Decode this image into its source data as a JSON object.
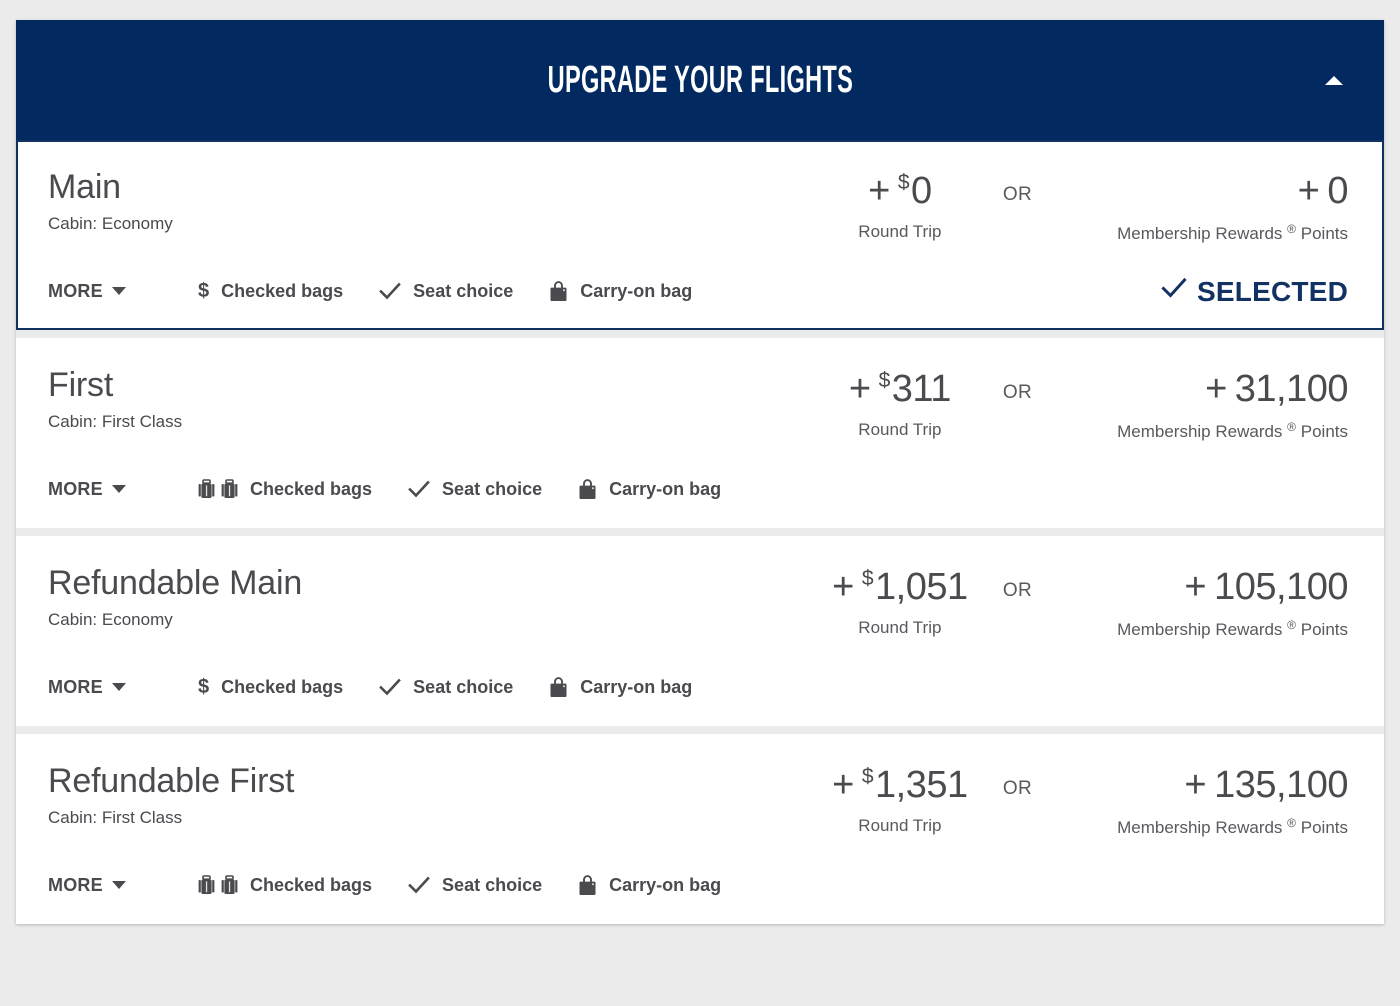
{
  "header": {
    "title": "UPGRADE YOUR FLIGHTS",
    "collapse_icon": "caret-up-icon",
    "background_color": "#032a60"
  },
  "theme": {
    "page_background": "#ebebeb",
    "navy": "#123263",
    "header_navy": "#032a60",
    "text_gray": "#4a4a4f",
    "muted_gray": "#59595e"
  },
  "labels": {
    "more": "MORE",
    "or": "OR",
    "round_trip": "Round Trip",
    "points_label": "Membership Rewards",
    "points_reg": "®",
    "points_suffix": "Points",
    "plus": "+",
    "currency_symbol": "$",
    "selected": "SELECTED"
  },
  "fares": [
    {
      "name": "Main",
      "cabin": "Cabin: Economy",
      "cash_amount": "0",
      "points_amount": "0",
      "selected": true,
      "features": [
        {
          "icon": "dollar-icon",
          "label": "Checked bags",
          "icon_count": 1
        },
        {
          "icon": "check-icon",
          "label": "Seat choice",
          "icon_count": 1
        },
        {
          "icon": "carry-on-bag-icon",
          "label": "Carry-on bag",
          "icon_count": 1
        }
      ]
    },
    {
      "name": "First",
      "cabin": "Cabin: First Class",
      "cash_amount": "311",
      "points_amount": "31,100",
      "selected": false,
      "features": [
        {
          "icon": "suitcase-icon",
          "label": "Checked bags",
          "icon_count": 2
        },
        {
          "icon": "check-icon",
          "label": "Seat choice",
          "icon_count": 1
        },
        {
          "icon": "carry-on-bag-icon",
          "label": "Carry-on bag",
          "icon_count": 1
        }
      ]
    },
    {
      "name": "Refundable Main",
      "cabin": "Cabin: Economy",
      "cash_amount": "1,051",
      "points_amount": "105,100",
      "selected": false,
      "features": [
        {
          "icon": "dollar-icon",
          "label": "Checked bags",
          "icon_count": 1
        },
        {
          "icon": "check-icon",
          "label": "Seat choice",
          "icon_count": 1
        },
        {
          "icon": "carry-on-bag-icon",
          "label": "Carry-on bag",
          "icon_count": 1
        }
      ]
    },
    {
      "name": "Refundable First",
      "cabin": "Cabin: First Class",
      "cash_amount": "1,351",
      "points_amount": "135,100",
      "selected": false,
      "features": [
        {
          "icon": "suitcase-icon",
          "label": "Checked bags",
          "icon_count": 2
        },
        {
          "icon": "check-icon",
          "label": "Seat choice",
          "icon_count": 1
        },
        {
          "icon": "carry-on-bag-icon",
          "label": "Carry-on bag",
          "icon_count": 1
        }
      ]
    }
  ]
}
